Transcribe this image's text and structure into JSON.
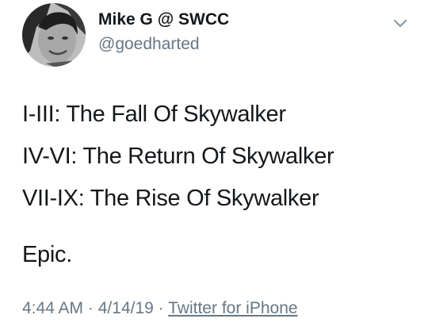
{
  "user": {
    "display_name": "Mike G @ SWCC",
    "handle": "@goedharted"
  },
  "tweet": {
    "lines": [
      "I-III: The Fall Of Skywalker",
      "IV-VI: The Return Of Skywalker",
      "VII-IX: The Rise Of Skywalker"
    ],
    "closing": "Epic."
  },
  "meta": {
    "time": "4:44 AM",
    "date": "4/14/19",
    "separator": "·",
    "source": "Twitter for iPhone"
  },
  "icons": {
    "menu": "chevron-down-icon",
    "avatar": "user-photo"
  },
  "colors": {
    "text": "#14171a",
    "secondary": "#657786"
  }
}
